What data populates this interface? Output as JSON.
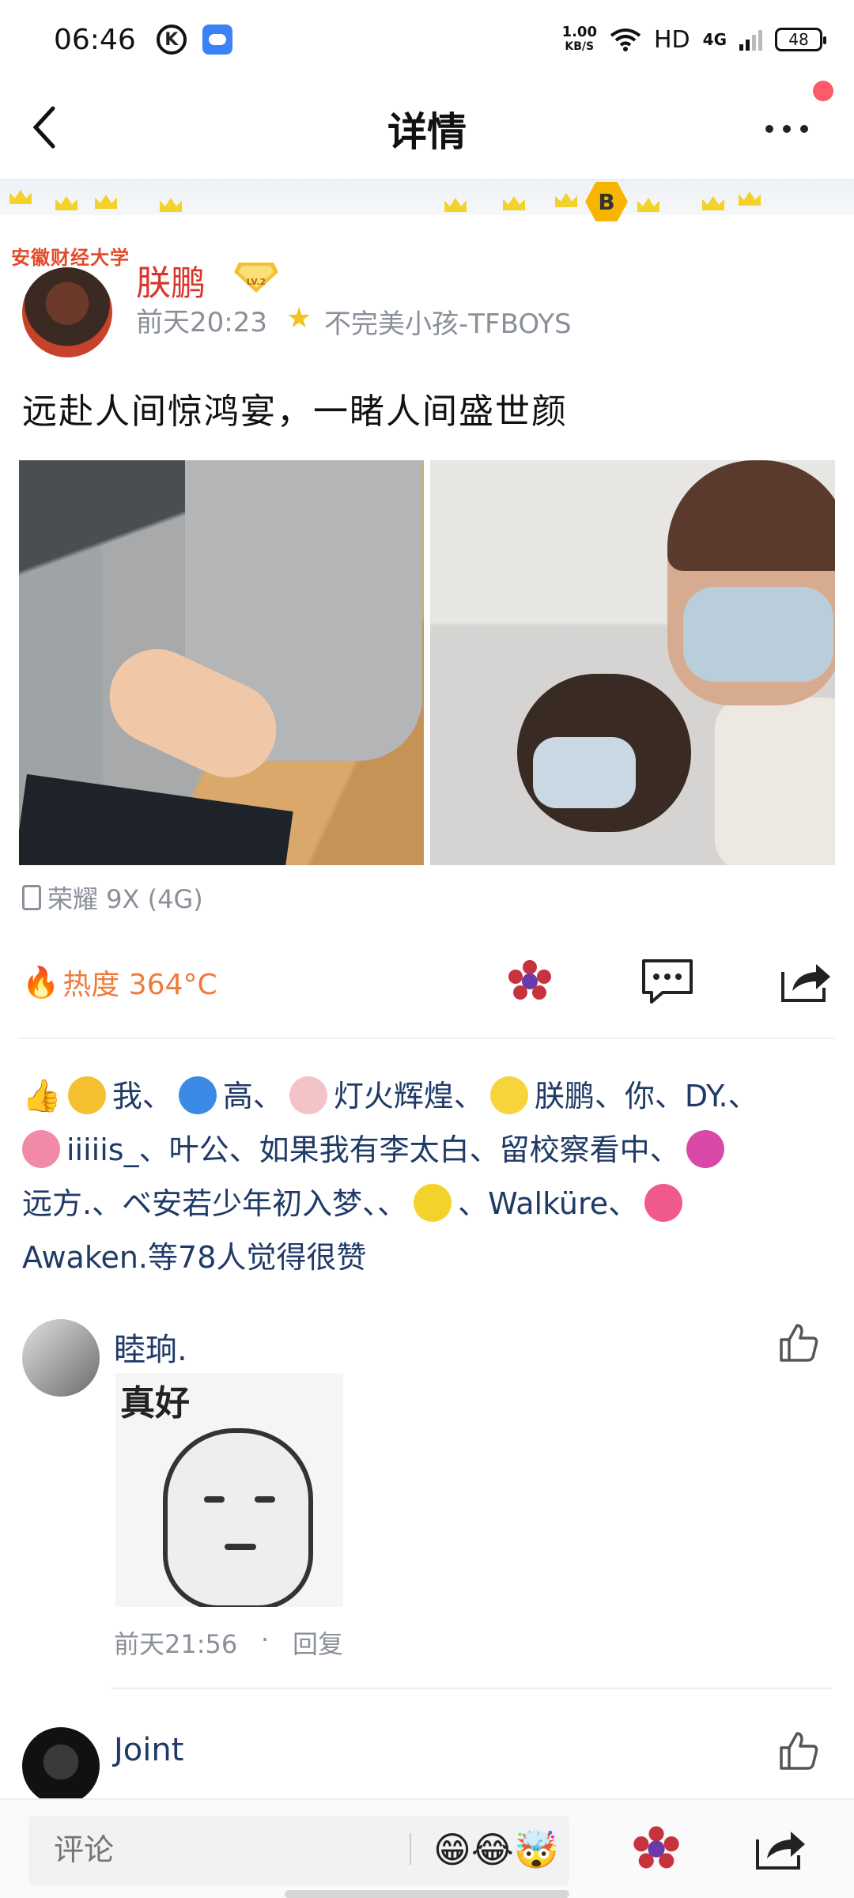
{
  "status_bar": {
    "time": "06:46",
    "k_icon": "K",
    "net_speed_value": "1.00",
    "net_speed_unit": "KB/S",
    "hd": "HD",
    "network": "4G",
    "battery": "48"
  },
  "header": {
    "title": "详情"
  },
  "post": {
    "school_tag": "安徽财经大学",
    "author": "朕鹏",
    "level": "LV.2",
    "time": "前天20:23",
    "fan_tag": "不完美小孩-TFBOYS",
    "text": "远赴人间惊鸿宴，一睹人间盛世颜",
    "device": "荣耀 9X (4G)"
  },
  "actions": {
    "heat_label": "热度 364°C"
  },
  "likes": {
    "names": [
      "我、",
      "高、",
      "灯火辉煌、",
      "朕鹏、你、DY.、",
      "iiiiis_、叶公、如果我有李太白、留校察看中、",
      "远方.、ベ安若少年初入梦、、",
      "、Walküre、",
      "Awaken.等78人觉得很赞"
    ]
  },
  "comments": [
    {
      "name": "睦珦.",
      "meme_text": "真好",
      "time": "前天21:56",
      "reply_label": "回复"
    },
    {
      "name": "Joint"
    }
  ],
  "bottom_bar": {
    "placeholder": "评论",
    "emojis": "😁😂🤯"
  },
  "colors": {
    "username_red": "#d9362b",
    "link_blue": "#1f3a66",
    "heat_orange": "#f07a3a",
    "meta_gray": "#8a8f99",
    "notify_dot": "#ff5a6a"
  }
}
